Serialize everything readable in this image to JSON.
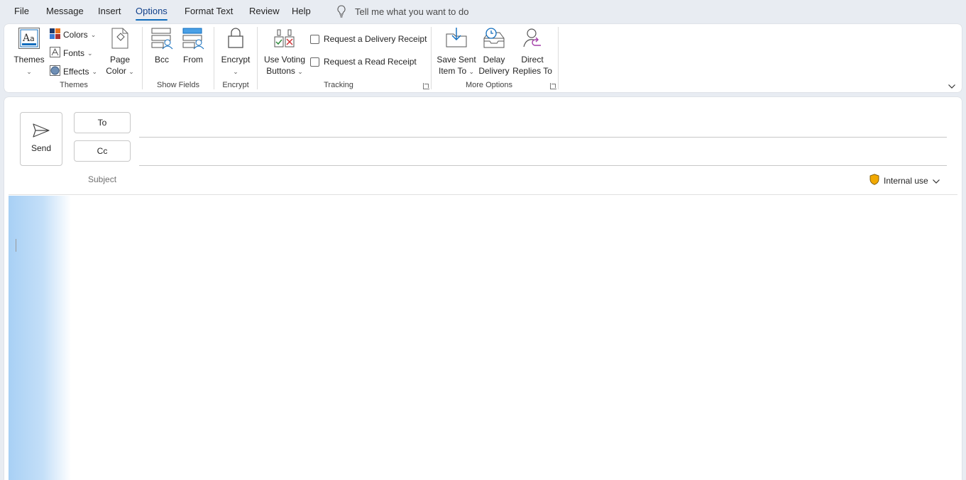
{
  "tabs": [
    {
      "label": "File"
    },
    {
      "label": "Message"
    },
    {
      "label": "Insert"
    },
    {
      "label": "Options"
    },
    {
      "label": "Format Text"
    },
    {
      "label": "Review"
    },
    {
      "label": "Help"
    }
  ],
  "tellme": {
    "text": "Tell me what you want to do"
  },
  "ribbon": {
    "themes": {
      "themes_label": "Themes",
      "colors": "Colors",
      "fonts": "Fonts",
      "effects": "Effects",
      "page_color_line1": "Page",
      "page_color_line2": "Color",
      "group": "Themes"
    },
    "show_fields": {
      "bcc": "Bcc",
      "from": "From",
      "group": "Show Fields"
    },
    "encrypt": {
      "label": "Encrypt",
      "group": "Encrypt"
    },
    "tracking": {
      "voting_line1": "Use Voting",
      "voting_line2": "Buttons",
      "delivery_receipt": "Request a Delivery Receipt",
      "read_receipt": "Request a Read Receipt",
      "group": "Tracking"
    },
    "more_options": {
      "save_sent_line1": "Save Sent",
      "save_sent_line2": "Item To",
      "delay_line1": "Delay",
      "delay_line2": "Delivery",
      "replies_line1": "Direct",
      "replies_line2": "Replies To",
      "group": "More Options"
    }
  },
  "compose": {
    "send": "Send",
    "to": "To",
    "cc": "Cc",
    "subject": "Subject",
    "sensitivity": "Internal use"
  },
  "colors": {
    "accent": "#0f6cbd",
    "shield": "#f2a900"
  }
}
